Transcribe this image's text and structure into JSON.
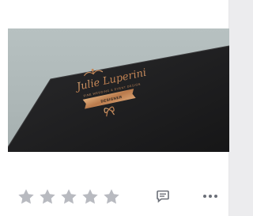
{
  "thumbnail": {
    "logo_script": "Julie Luperini",
    "logo_tagline": "FINE WEDDING & EVENT DESIGN",
    "logo_banner": "DESIGNER",
    "colors": {
      "background": "#b3bdbd",
      "card_stock": "#202022",
      "foil": "#c48a5c"
    }
  },
  "rating": {
    "max": 5,
    "value": 0,
    "star_color": "#b8bac0"
  },
  "actions": {
    "comment_icon": "comment-icon",
    "more_icon": "more-horizontal-icon",
    "icon_color": "#6b6f78"
  }
}
